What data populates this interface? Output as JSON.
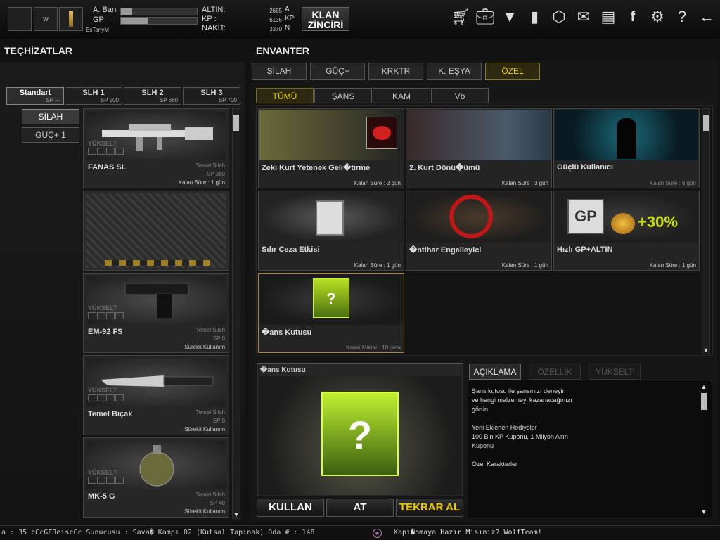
{
  "player": {
    "stat1_label": "A. Barı",
    "stat2_label": "GP",
    "stat1_progress": 0.15,
    "stat2_progress": 0.35,
    "nick": "EsTanyM"
  },
  "currency": [
    {
      "label": "ALTIN:",
      "value": "2685",
      "unit": "A"
    },
    {
      "label": "KP   :",
      "value": "6136",
      "unit": "KP"
    },
    {
      "label": "NAKİT:",
      "value": "3370",
      "unit": "N"
    }
  ],
  "klan_button": {
    "line1": "KLAN",
    "line2": "ZİNCİRİ"
  },
  "top_icons": [
    "cart-icon",
    "bag-icon",
    "wolf-icon",
    "book-icon",
    "box-icon",
    "mail-icon",
    "folder-user-icon",
    "facebook-icon",
    "gear-icon",
    "help-icon",
    "back-arrow-icon"
  ],
  "titles": {
    "left": "TEÇHİZATLAR",
    "right": "ENVANTER"
  },
  "slot_tabs": [
    {
      "name": "Standart",
      "sp": "SP ---"
    },
    {
      "name": "SLH 1",
      "sp": "SP 500"
    },
    {
      "name": "SLH 2",
      "sp": "SP 660"
    },
    {
      "name": "SLH 3",
      "sp": "SP 700"
    }
  ],
  "side_buttons": [
    "SİLAH",
    "GÜÇ+ 1"
  ],
  "equipment": [
    {
      "name": "FANAS SL",
      "type": "Temel Silah",
      "sp": "SP 360",
      "time": "Kalan Süre : 1 gün",
      "upgrade": "YÜKSELT"
    },
    {
      "name": "",
      "type": "",
      "sp": "",
      "time": "",
      "upgrade": ""
    },
    {
      "name": "EM-92 FS",
      "type": "Temel Silah",
      "sp": "SP 0",
      "time": "Sürekli Kullanım",
      "upgrade": "YÜKSELT"
    },
    {
      "name": "Temel Bıçak",
      "type": "Temel Silah",
      "sp": "SP 0",
      "time": "Sürekli Kullanım",
      "upgrade": "YÜKSELT"
    },
    {
      "name": "MK-5 G",
      "type": "Temel Silah",
      "sp": "SP 40",
      "time": "Sürekli Kullanım",
      "upgrade": "YÜKSELT"
    }
  ],
  "category_tabs": [
    "SİLAH",
    "GÜÇ+",
    "KRKTR",
    "K. EŞYA",
    "ÖZEL"
  ],
  "sub_tabs": [
    "TÜMÜ",
    "ŞANS KUTUSU",
    "KAM",
    "Vb"
  ],
  "inventory": [
    {
      "name": "Zeki Kurt Yetenek Geli�tirme",
      "time": "Kalan Süre : 2 gün"
    },
    {
      "name": "2. Kurt Dönü�ümü",
      "time": "Kalan Süre : 3 gün"
    },
    {
      "name": "Güçlü Kullanıcı",
      "time": "Kalan Süre : 6 gün"
    },
    {
      "name": "Sıfır Ceza Etkisi",
      "time": "Kalan Süre : 1 gün"
    },
    {
      "name": "�ntihar Engelleyici",
      "time": "Kalan Süre : 1 gün"
    },
    {
      "name": "Hızlı GP+ALTIN",
      "time": "Kalan Süre : 1 gün",
      "badge": "+30%"
    },
    {
      "name": "�ans Kutusu",
      "time": "Kalan Miktar : 10 defa"
    }
  ],
  "detail": {
    "title": "�ans Kutusu"
  },
  "actions": [
    "KULLAN",
    "AT",
    "TEKRAR AL"
  ],
  "desc_tabs": [
    "AÇIKLAMA",
    "ÖZELLİK",
    "YÜKSELT"
  ],
  "description": "Şans kutusu ile şansınızı deneyin\nve hangi malzemeyi kazanacağınızı\n görün.\n\nYeni Eklenen Hediyeler\n100 Bin KP Kuponu, 1 Milyon Altın\nKuponu\n\nÖzel Karakterler",
  "status": {
    "left": "a : 35 cCcGFReiscCc Sunucusu : Sava� Kampı 02 (Kutsal Tapınak) Oda # : 148",
    "message": "Kapı�omaya Hazır Mısınız? WolfTeam!"
  },
  "colors": {
    "accent": "#f0d000",
    "action_gold": "#f0c800",
    "background": "#121212"
  }
}
